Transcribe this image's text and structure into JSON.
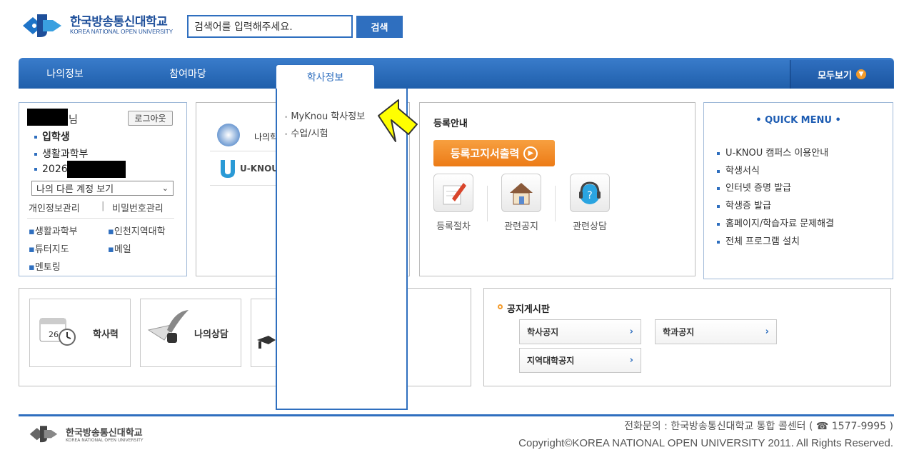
{
  "header": {
    "logo_ko": "한국방송통신대학교",
    "logo_en": "KOREA NATIONAL OPEN UNIVERSITY",
    "search_placeholder": "검색어를 입력해주세요.",
    "search_button": "검색"
  },
  "nav": {
    "items": [
      "나의정보",
      "참여마당",
      "학사정보"
    ],
    "active": "학사정보",
    "all_label": "모두보기"
  },
  "dropdown": {
    "items": [
      "MyKnou 학사정보",
      "수업/시험"
    ]
  },
  "user": {
    "suffix": "님",
    "logout": "로그아웃",
    "info": [
      "입학생",
      "생활과학부",
      "2026"
    ],
    "account_select": "나의 다른 계정 보기",
    "links": [
      "개인정보관리",
      "비밀번호관리"
    ],
    "shortcuts": [
      "생활과학부",
      "인천지역대학",
      "튜터지도",
      "메일",
      "멘토링"
    ]
  },
  "center_panel": {
    "items": [
      "나의학",
      "U-KNOU"
    ]
  },
  "registration": {
    "title": "등록안내",
    "print_button": "등록고지서출력",
    "tiles": [
      "등록절차",
      "관련공지",
      "관련상담"
    ]
  },
  "quick_menu": {
    "title": "QUICK MENU",
    "items": [
      "U-KNOU 캠퍼스 이용안내",
      "학생서식",
      "인터넷 증명 발급",
      "학생증 발급",
      "홈페이지/학습자료 문제해결",
      "전체 프로그램 설치"
    ]
  },
  "shortcut_tiles": [
    "학사력",
    "나의상담"
  ],
  "notice": {
    "title": "공지게시판",
    "buttons": [
      "학사공지",
      "학과공지",
      "지역대학공지"
    ]
  },
  "footer": {
    "logo_ko": "한국방송통신대학교",
    "logo_en": "KOREA NATIONAL OPEN UNIVERSITY",
    "phone": "전화문의 : 한국방송통신대학교 통합 콜센터 ( ☎ 1577-9995 )",
    "copyright": "Copyright©KOREA NATIONAL OPEN UNIVERSITY 2011. All Rights Reserved."
  },
  "colors": {
    "brand_blue": "#2f6fbf",
    "orange": "#ec7b16",
    "arrow_yellow": "#ffff00"
  }
}
